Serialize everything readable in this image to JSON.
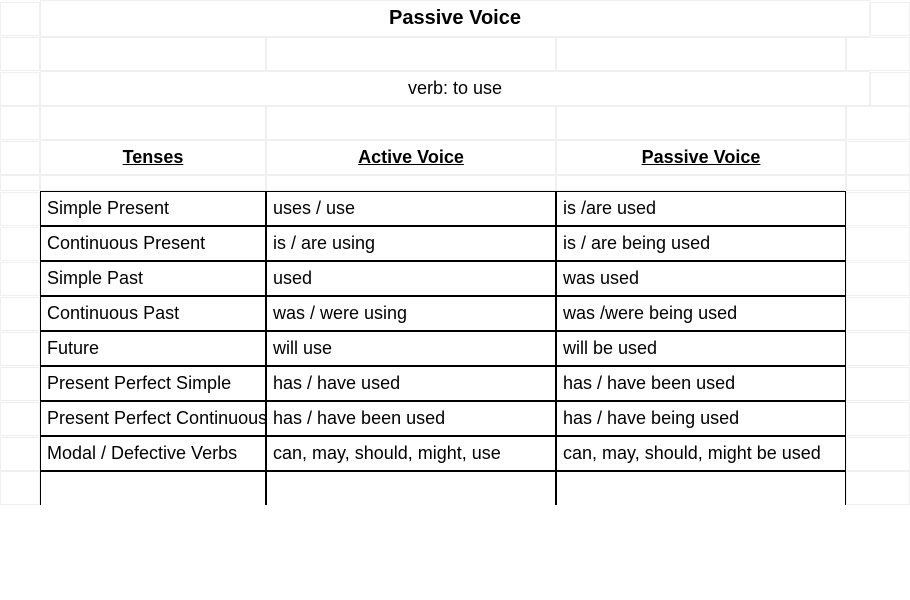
{
  "title": "Passive Voice",
  "subtitle": "verb: to use",
  "headers": {
    "col1": "Tenses",
    "col2": "Active Voice",
    "col3": "Passive Voice"
  },
  "rows": [
    {
      "tense": "Simple Present",
      "active": "uses / use",
      "passive": "is /are used"
    },
    {
      "tense": "Continuous Present",
      "active": "is / are using",
      "passive": "is / are being used"
    },
    {
      "tense": "Simple Past",
      "active": "used",
      "passive": "was used"
    },
    {
      "tense": "Continuous Past",
      "active": "was / were using",
      "passive": "was /were being used"
    },
    {
      "tense": "Future",
      "active": "will use",
      "passive": "will be used"
    },
    {
      "tense": "Present Perfect Simple",
      "active": "has / have used",
      "passive": "has / have been used"
    },
    {
      "tense": "Present Perfect Continuous",
      "active": "has / have been used",
      "passive": "has / have being used"
    },
    {
      "tense": "Modal / Defective Verbs",
      "active": "can, may, should, might, use",
      "passive": "can, may, should, might be used"
    }
  ]
}
